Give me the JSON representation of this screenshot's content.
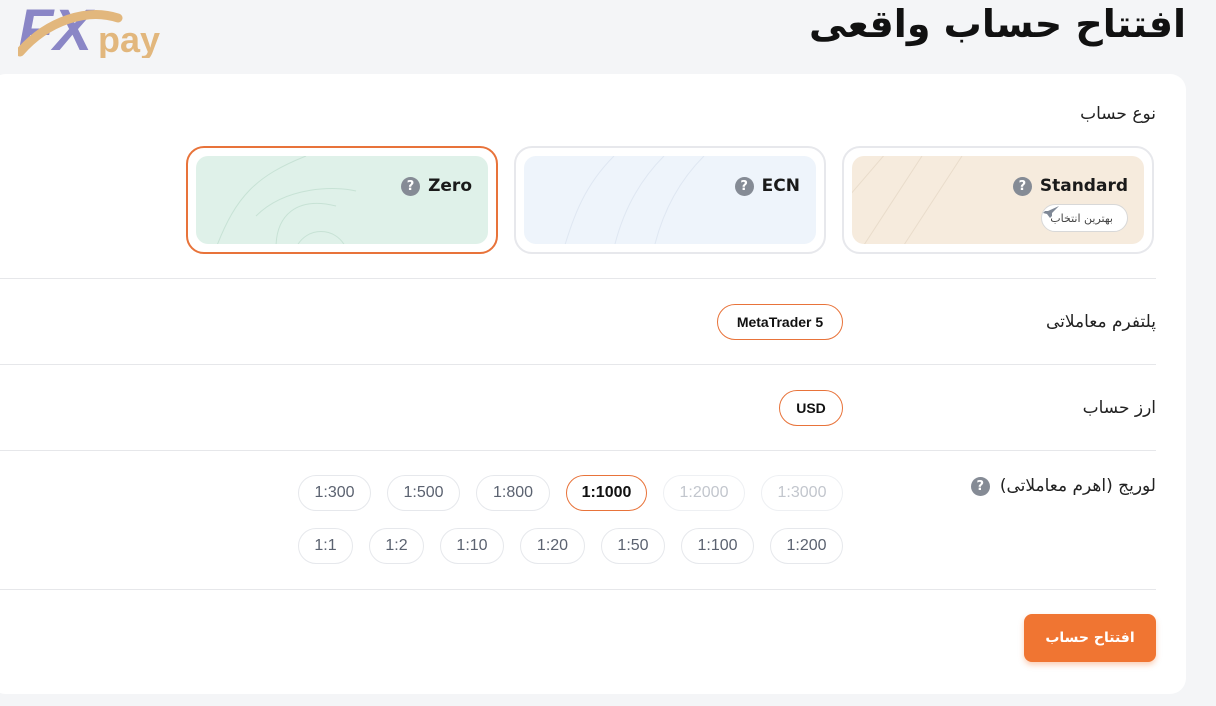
{
  "header": {
    "logo_text_fx": "FX",
    "logo_text_pay": "pay",
    "title": "افتتاح حساب واقعی"
  },
  "account_type": {
    "label": "نوع حساب",
    "options": [
      {
        "name": "Standard",
        "badge": "بهترین انتخاب",
        "bg": "#f6ebdd",
        "selected": false
      },
      {
        "name": "ECN",
        "bg": "#eef4fb",
        "selected": false
      },
      {
        "name": "Zero",
        "bg": "#dff1e9",
        "selected": true
      }
    ]
  },
  "platform": {
    "label": "پلتفرم معاملاتی",
    "value": "MetaTrader 5"
  },
  "currency": {
    "label": "ارز حساب",
    "value": "USD"
  },
  "leverage": {
    "label": "لوریج (اهرم معاملاتی)",
    "row1": [
      "1:3000",
      "1:2000",
      "1:1000",
      "1:800",
      "1:500",
      "1:300"
    ],
    "row2": [
      "1:200",
      "1:100",
      "1:50",
      "1:20",
      "1:10",
      "1:2",
      "1:1"
    ],
    "selected": "1:1000",
    "disabled": [
      "1:3000",
      "1:2000"
    ]
  },
  "submit": {
    "label": "افتتاح حساب"
  },
  "colors": {
    "accent": "#f07532",
    "logo_purple": "#8a86c6",
    "logo_gold": "#e2b77d"
  }
}
